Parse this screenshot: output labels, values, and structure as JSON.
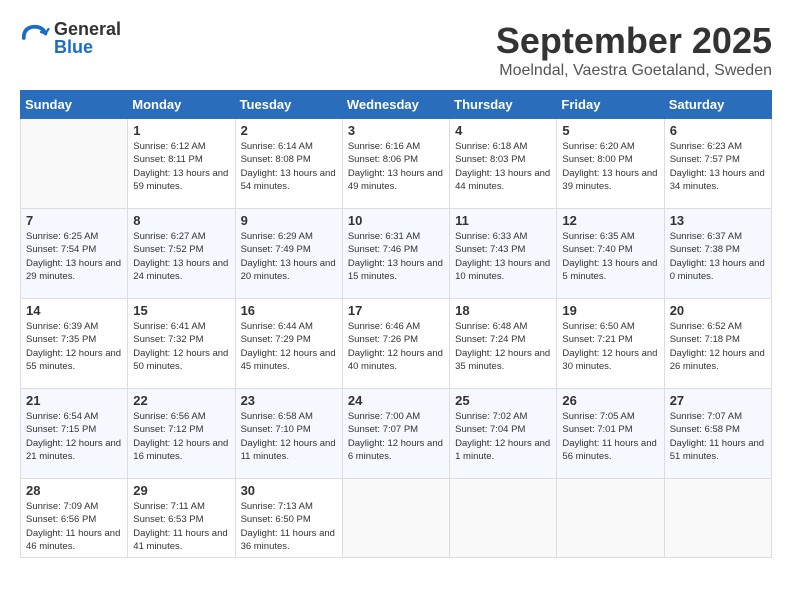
{
  "header": {
    "logo": {
      "general": "General",
      "blue": "Blue"
    },
    "title": "September 2025",
    "location": "Moelndal, Vaestra Goetaland, Sweden"
  },
  "weekdays": [
    "Sunday",
    "Monday",
    "Tuesday",
    "Wednesday",
    "Thursday",
    "Friday",
    "Saturday"
  ],
  "weeks": [
    {
      "days": [
        {
          "num": "",
          "empty": true
        },
        {
          "num": "1",
          "info": "Sunrise: 6:12 AM\nSunset: 8:11 PM\nDaylight: 13 hours\nand 59 minutes."
        },
        {
          "num": "2",
          "info": "Sunrise: 6:14 AM\nSunset: 8:08 PM\nDaylight: 13 hours\nand 54 minutes."
        },
        {
          "num": "3",
          "info": "Sunrise: 6:16 AM\nSunset: 8:06 PM\nDaylight: 13 hours\nand 49 minutes."
        },
        {
          "num": "4",
          "info": "Sunrise: 6:18 AM\nSunset: 8:03 PM\nDaylight: 13 hours\nand 44 minutes."
        },
        {
          "num": "5",
          "info": "Sunrise: 6:20 AM\nSunset: 8:00 PM\nDaylight: 13 hours\nand 39 minutes."
        },
        {
          "num": "6",
          "info": "Sunrise: 6:23 AM\nSunset: 7:57 PM\nDaylight: 13 hours\nand 34 minutes."
        }
      ]
    },
    {
      "days": [
        {
          "num": "7",
          "info": "Sunrise: 6:25 AM\nSunset: 7:54 PM\nDaylight: 13 hours\nand 29 minutes."
        },
        {
          "num": "8",
          "info": "Sunrise: 6:27 AM\nSunset: 7:52 PM\nDaylight: 13 hours\nand 24 minutes."
        },
        {
          "num": "9",
          "info": "Sunrise: 6:29 AM\nSunset: 7:49 PM\nDaylight: 13 hours\nand 20 minutes."
        },
        {
          "num": "10",
          "info": "Sunrise: 6:31 AM\nSunset: 7:46 PM\nDaylight: 13 hours\nand 15 minutes."
        },
        {
          "num": "11",
          "info": "Sunrise: 6:33 AM\nSunset: 7:43 PM\nDaylight: 13 hours\nand 10 minutes."
        },
        {
          "num": "12",
          "info": "Sunrise: 6:35 AM\nSunset: 7:40 PM\nDaylight: 13 hours\nand 5 minutes."
        },
        {
          "num": "13",
          "info": "Sunrise: 6:37 AM\nSunset: 7:38 PM\nDaylight: 13 hours\nand 0 minutes."
        }
      ]
    },
    {
      "days": [
        {
          "num": "14",
          "info": "Sunrise: 6:39 AM\nSunset: 7:35 PM\nDaylight: 12 hours\nand 55 minutes."
        },
        {
          "num": "15",
          "info": "Sunrise: 6:41 AM\nSunset: 7:32 PM\nDaylight: 12 hours\nand 50 minutes."
        },
        {
          "num": "16",
          "info": "Sunrise: 6:44 AM\nSunset: 7:29 PM\nDaylight: 12 hours\nand 45 minutes."
        },
        {
          "num": "17",
          "info": "Sunrise: 6:46 AM\nSunset: 7:26 PM\nDaylight: 12 hours\nand 40 minutes."
        },
        {
          "num": "18",
          "info": "Sunrise: 6:48 AM\nSunset: 7:24 PM\nDaylight: 12 hours\nand 35 minutes."
        },
        {
          "num": "19",
          "info": "Sunrise: 6:50 AM\nSunset: 7:21 PM\nDaylight: 12 hours\nand 30 minutes."
        },
        {
          "num": "20",
          "info": "Sunrise: 6:52 AM\nSunset: 7:18 PM\nDaylight: 12 hours\nand 26 minutes."
        }
      ]
    },
    {
      "days": [
        {
          "num": "21",
          "info": "Sunrise: 6:54 AM\nSunset: 7:15 PM\nDaylight: 12 hours\nand 21 minutes."
        },
        {
          "num": "22",
          "info": "Sunrise: 6:56 AM\nSunset: 7:12 PM\nDaylight: 12 hours\nand 16 minutes."
        },
        {
          "num": "23",
          "info": "Sunrise: 6:58 AM\nSunset: 7:10 PM\nDaylight: 12 hours\nand 11 minutes."
        },
        {
          "num": "24",
          "info": "Sunrise: 7:00 AM\nSunset: 7:07 PM\nDaylight: 12 hours\nand 6 minutes."
        },
        {
          "num": "25",
          "info": "Sunrise: 7:02 AM\nSunset: 7:04 PM\nDaylight: 12 hours\nand 1 minute."
        },
        {
          "num": "26",
          "info": "Sunrise: 7:05 AM\nSunset: 7:01 PM\nDaylight: 11 hours\nand 56 minutes."
        },
        {
          "num": "27",
          "info": "Sunrise: 7:07 AM\nSunset: 6:58 PM\nDaylight: 11 hours\nand 51 minutes."
        }
      ]
    },
    {
      "days": [
        {
          "num": "28",
          "info": "Sunrise: 7:09 AM\nSunset: 6:56 PM\nDaylight: 11 hours\nand 46 minutes."
        },
        {
          "num": "29",
          "info": "Sunrise: 7:11 AM\nSunset: 6:53 PM\nDaylight: 11 hours\nand 41 minutes."
        },
        {
          "num": "30",
          "info": "Sunrise: 7:13 AM\nSunset: 6:50 PM\nDaylight: 11 hours\nand 36 minutes."
        },
        {
          "num": "",
          "empty": true
        },
        {
          "num": "",
          "empty": true
        },
        {
          "num": "",
          "empty": true
        },
        {
          "num": "",
          "empty": true
        }
      ]
    }
  ]
}
